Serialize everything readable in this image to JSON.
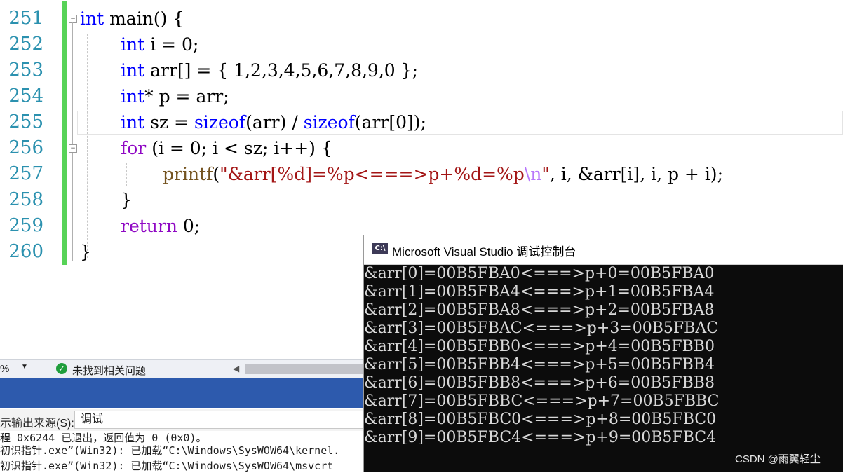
{
  "editor": {
    "line_numbers": [
      "251",
      "252",
      "253",
      "254",
      "255",
      "256",
      "257",
      "258",
      "259",
      "260"
    ],
    "lines": {
      "l251": {
        "kw": "int",
        "rest": " main() {"
      },
      "l252": {
        "kw": "int",
        "rest": " i = 0;"
      },
      "l253": {
        "kw": "int",
        "rest": " arr[] = { 1,2,3,4,5,6,7,8,9,0 };"
      },
      "l254": {
        "kw": "int",
        "rest": "* p = arr;"
      },
      "l255": {
        "kw": "int",
        "a": " sz = ",
        "f1": "sizeof",
        "b": "(arr) / ",
        "f2": "sizeof",
        "c": "(arr[0]);"
      },
      "l256": {
        "kw": "for",
        "rest": " (i = 0; i < sz; i++) {"
      },
      "l257": {
        "fn": "printf",
        "open": "(",
        "str": "\"&arr[%d]=%p<===>p+%d=%p",
        "esc": "\\n",
        "strend": "\"",
        "rest": ", i, &arr[i], i, p + i);"
      },
      "l258": {
        "rest": "}"
      },
      "l259": {
        "kw": "return",
        "rest": " 0;"
      },
      "l260": {
        "rest": "}"
      }
    },
    "colors": {
      "keyword": "#0000ff",
      "string": "#a31515",
      "line_number": "#2b91af",
      "change_bar": "#57d357"
    }
  },
  "statusbar": {
    "zoom": "%",
    "issues_label": "未找到相关问题"
  },
  "output": {
    "source_label": "示输出来源(S):",
    "source_value": "调试",
    "lines": [
      "程 0x6244 已退出，返回值为 0 (0x0)。",
      "初识指针.exe”(Win32): 已加载“C:\\Windows\\SysWOW64\\kernel.",
      "初识指针.exe”(Win32): 已加载“C:\\Windows\\SysWOW64\\msvcrt"
    ]
  },
  "console": {
    "icon_text": "C:\\",
    "title": "Microsoft Visual Studio 调试控制台",
    "lines": [
      "&arr[0]=00B5FBA0<===>p+0=00B5FBA0",
      "&arr[1]=00B5FBA4<===>p+1=00B5FBA4",
      "&arr[2]=00B5FBA8<===>p+2=00B5FBA8",
      "&arr[3]=00B5FBAC<===>p+3=00B5FBAC",
      "&arr[4]=00B5FBB0<===>p+4=00B5FBB0",
      "&arr[5]=00B5FBB4<===>p+5=00B5FBB4",
      "&arr[6]=00B5FBB8<===>p+6=00B5FBB8",
      "&arr[7]=00B5FBBC<===>p+7=00B5FBBC",
      "&arr[8]=00B5FBC0<===>p+8=00B5FBC0",
      "&arr[9]=00B5FBC4<===>p+9=00B5FBC4"
    ]
  },
  "watermark": "CSDN @雨翼轻尘"
}
